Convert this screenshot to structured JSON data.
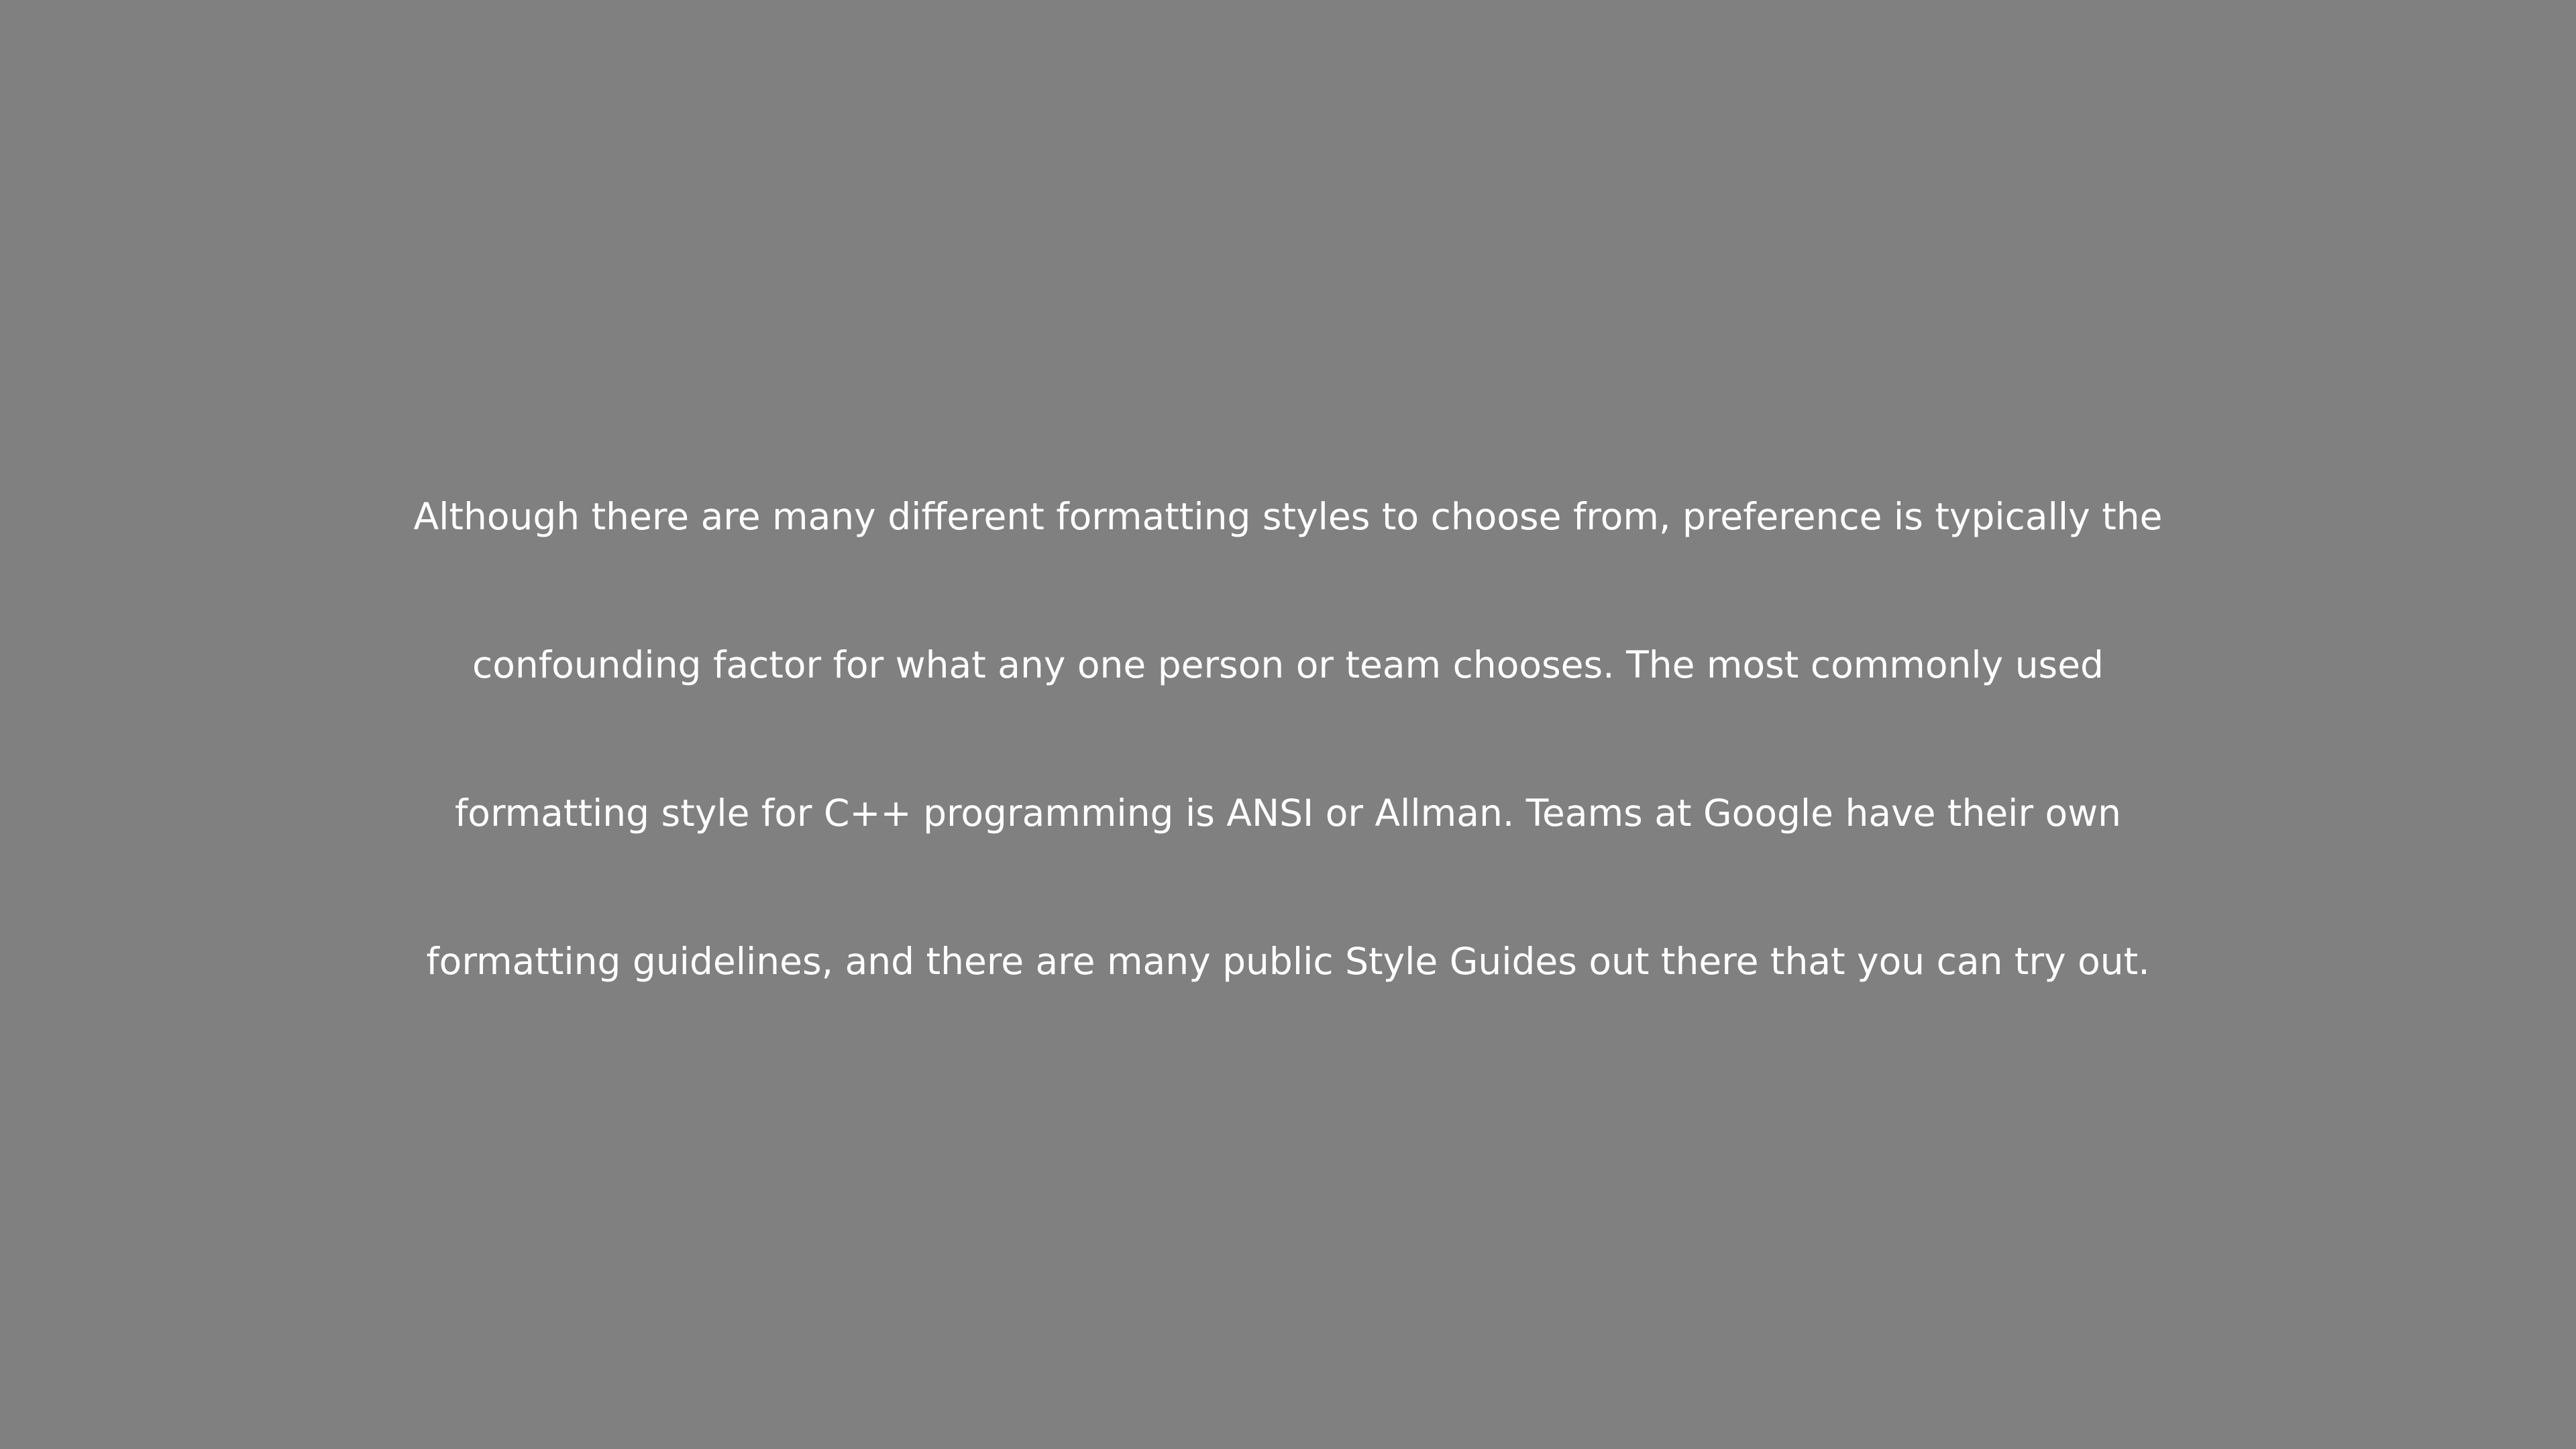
{
  "screen": {
    "background_color": "#808080",
    "text_color": "#ffffff"
  },
  "caption": {
    "lines": [
      "Although there are many different formatting styles to choose from, preference is typically the",
      "confounding factor for what any one person or team chooses. The most commonly used",
      "formatting style for C++ programming is ANSI or Allman. Teams at Google have their own",
      "formatting guidelines, and there are many public Style Guides out there that you can try out."
    ]
  }
}
